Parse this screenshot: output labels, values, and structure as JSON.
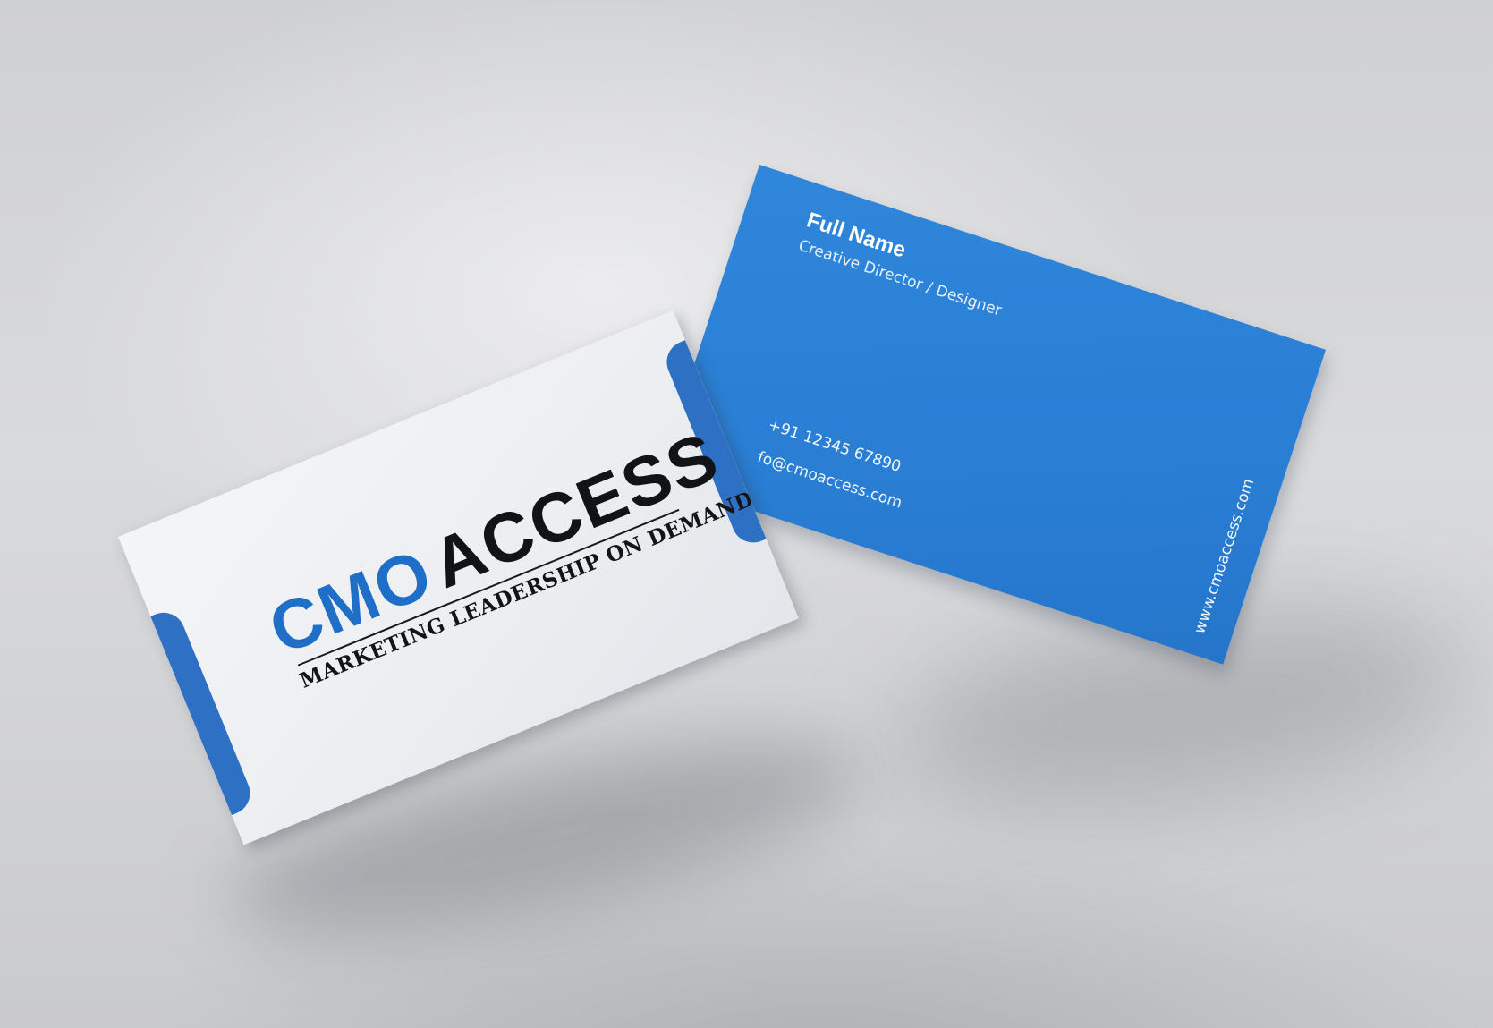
{
  "back_card": {
    "full_name": "Full Name",
    "job_title": "Creative Director / Designer",
    "phone": "+91 12345 67890",
    "email": "fo@cmoaccess.com",
    "website": "www.cmoaccess.com"
  },
  "front_card": {
    "logo_part1": "CMO",
    "logo_part2": "ACCESS",
    "tagline": "MARKETING LEADERSHIP ON DEMAND"
  },
  "colors": {
    "brand_blue": "#2a7fd5",
    "accent_blue": "#2d70c4",
    "card_white": "#eceef1",
    "ink_black": "#121315"
  }
}
